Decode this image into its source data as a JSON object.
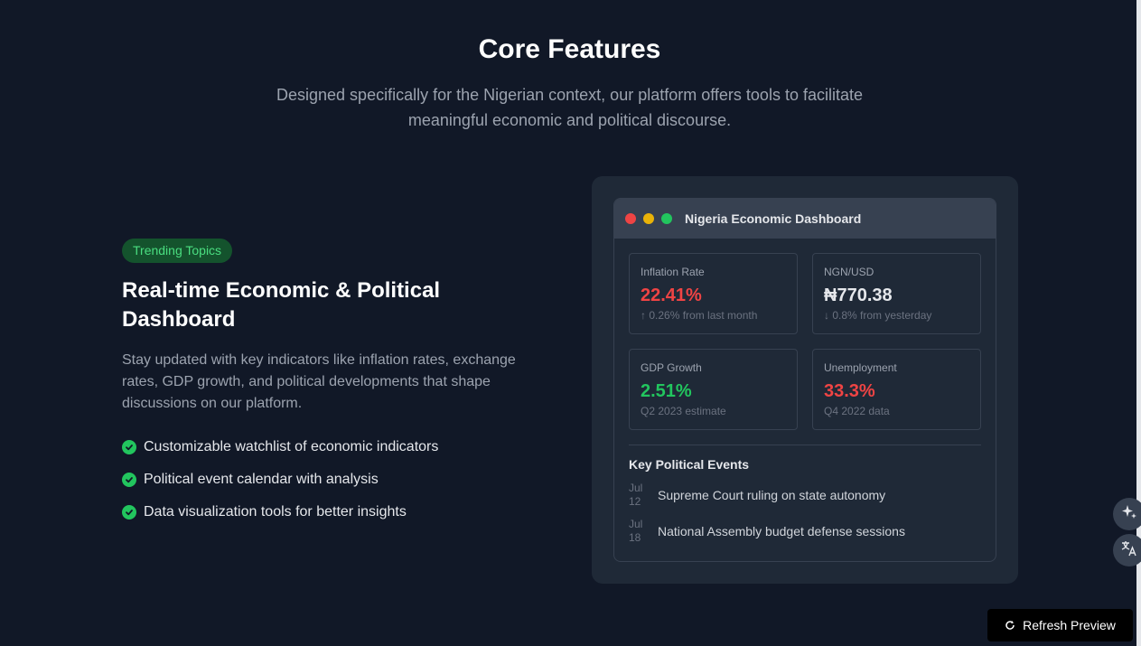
{
  "header": {
    "title": "Core Features",
    "subtitle": "Designed specifically for the Nigerian context, our platform offers tools to facilitate meaningful economic and political discourse."
  },
  "feature": {
    "badge": "Trending Topics",
    "heading": "Real-time Economic & Political Dashboard",
    "description": "Stay updated with key indicators like inflation rates, exchange rates, GDP growth, and political developments that shape discussions on our platform.",
    "items": [
      "Customizable watchlist of economic indicators",
      "Political event calendar with analysis",
      "Data visualization tools for better insights"
    ]
  },
  "dashboard": {
    "title": "Nigeria Economic Dashboard",
    "stats": [
      {
        "label": "Inflation Rate",
        "value": "22.41%",
        "note": "↑ 0.26% from last month",
        "color": "#ef4444"
      },
      {
        "label": "NGN/USD",
        "value": "₦770.38",
        "note": "↓ 0.8% from yesterday",
        "color": "#e5e7eb"
      },
      {
        "label": "GDP Growth",
        "value": "2.51%",
        "note": "Q2 2023 estimate",
        "color": "#22c55e"
      },
      {
        "label": "Unemployment",
        "value": "33.3%",
        "note": "Q4 2022 data",
        "color": "#ef4444"
      }
    ],
    "events_title": "Key Political Events",
    "events": [
      {
        "month": "Jul",
        "day": "12",
        "text": "Supreme Court ruling on state autonomy"
      },
      {
        "month": "Jul",
        "day": "18",
        "text": "National Assembly budget defense sessions"
      }
    ]
  },
  "toolbar": {
    "refresh_label": "Refresh Preview"
  },
  "icons": {
    "side_top": "sparkles-icon",
    "side_bottom": "translate-icon",
    "refresh": "refresh-icon",
    "check": "check-circle-icon"
  }
}
